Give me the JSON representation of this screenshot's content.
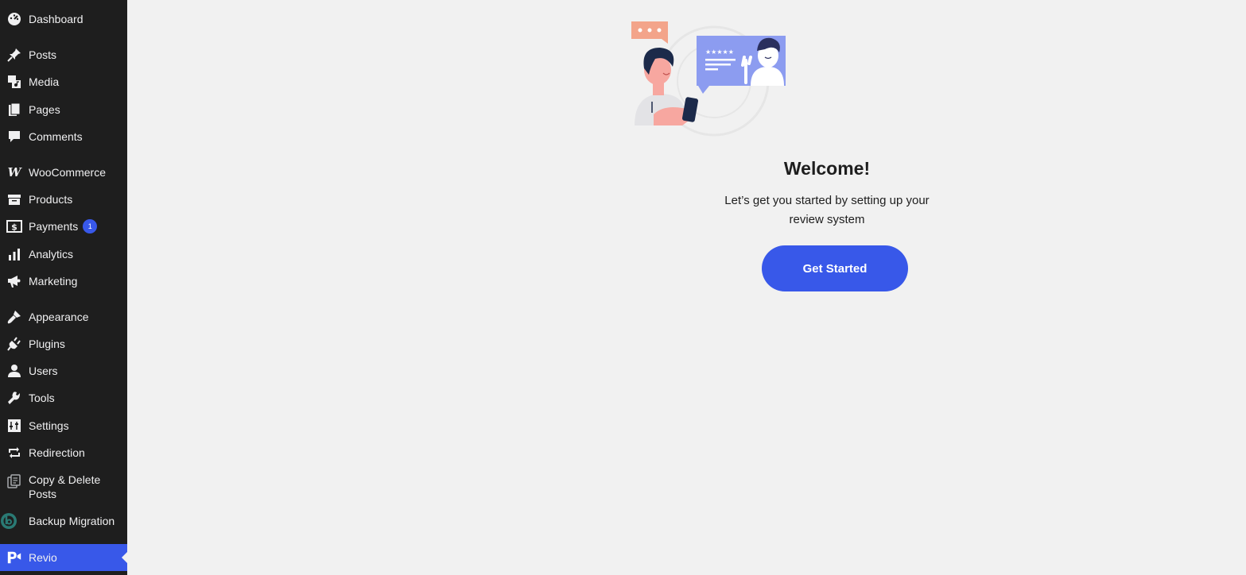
{
  "sidebar": {
    "items": [
      {
        "label": "Dashboard",
        "icon": "dashboard-icon"
      },
      {
        "label": "Posts",
        "icon": "pin-icon"
      },
      {
        "label": "Media",
        "icon": "media-icon"
      },
      {
        "label": "Pages",
        "icon": "pages-icon"
      },
      {
        "label": "Comments",
        "icon": "comment-icon"
      },
      {
        "label": "WooCommerce",
        "icon": "woocommerce-icon"
      },
      {
        "label": "Products",
        "icon": "archive-icon"
      },
      {
        "label": "Payments",
        "icon": "dollar-icon",
        "badge": "1"
      },
      {
        "label": "Analytics",
        "icon": "bar-chart-icon"
      },
      {
        "label": "Marketing",
        "icon": "megaphone-icon"
      },
      {
        "label": "Appearance",
        "icon": "paintbrush-icon"
      },
      {
        "label": "Plugins",
        "icon": "plugin-icon"
      },
      {
        "label": "Users",
        "icon": "user-icon"
      },
      {
        "label": "Tools",
        "icon": "wrench-icon"
      },
      {
        "label": "Settings",
        "icon": "settings-icon"
      },
      {
        "label": "Redirection",
        "icon": "redirect-icon"
      },
      {
        "label": "Copy & Delete Posts",
        "icon": "copy-icon"
      },
      {
        "label": "Backup Migration",
        "icon": "backup-icon"
      },
      {
        "label": "Revio",
        "icon": "revio-icon",
        "active": true
      }
    ]
  },
  "main": {
    "title": "Welcome!",
    "description": "Let’s get you started by setting up your review system",
    "button_label": "Get Started"
  },
  "colors": {
    "sidebar_bg": "#1e1e1e",
    "accent": "#3858e9",
    "page_bg": "#f1f1f1"
  }
}
